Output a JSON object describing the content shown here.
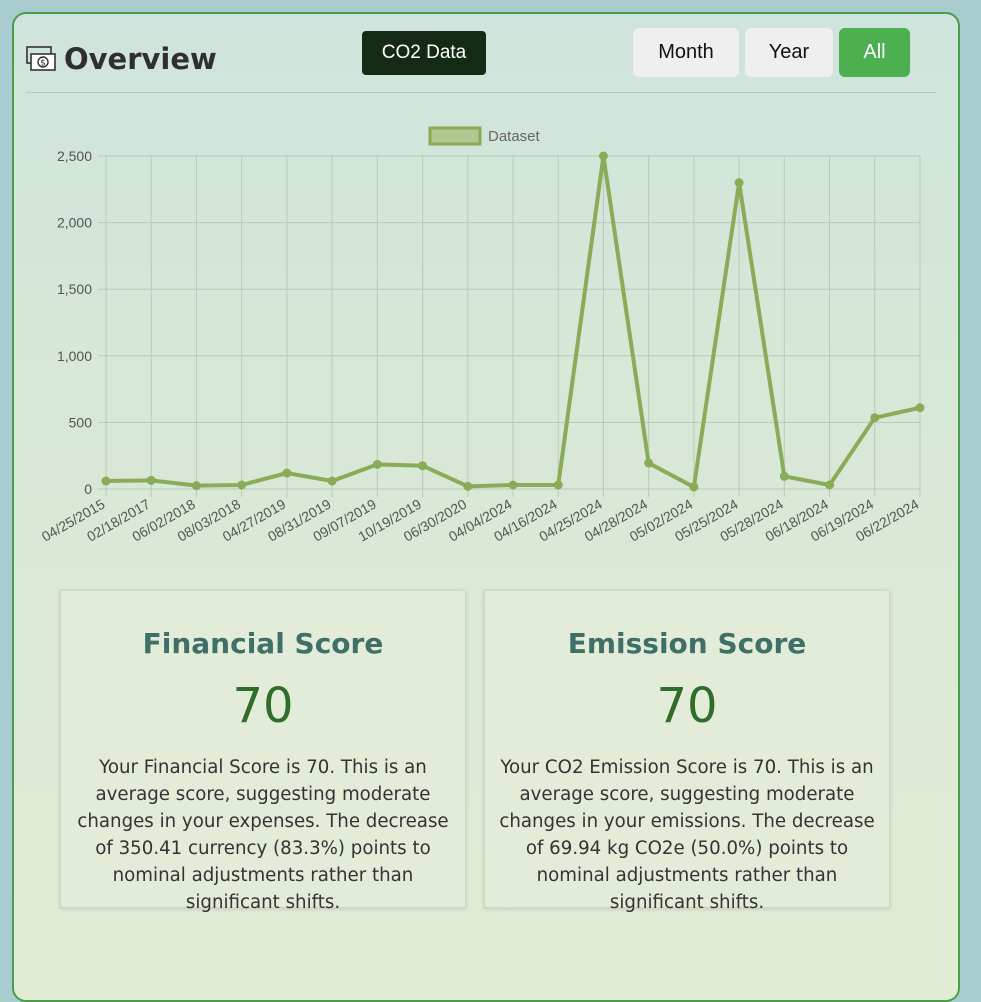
{
  "header": {
    "title": "Overview",
    "icon": "money-icon",
    "co2_button": "CO2 Data",
    "range_buttons": [
      "Month",
      "Year",
      "All"
    ],
    "active_range": "All"
  },
  "colors": {
    "accent": "#4caf50",
    "line": "#8aab58",
    "dark_button": "#142a14",
    "score_title": "#3e7068",
    "score_value": "#2f6e2a"
  },
  "chart_data": {
    "type": "line",
    "legend": "Dataset",
    "legend_position": "top",
    "grid": true,
    "ylim": [
      0,
      2500
    ],
    "y_ticks": [
      "0",
      "500",
      "1,000",
      "1,500",
      "2,000",
      "2,500"
    ],
    "categories": [
      "04/25/2015",
      "02/18/2017",
      "06/02/2018",
      "08/03/2018",
      "04/27/2019",
      "08/31/2019",
      "09/07/2019",
      "10/19/2019",
      "06/30/2020",
      "04/04/2024",
      "04/16/2024",
      "04/25/2024",
      "04/28/2024",
      "05/02/2024",
      "05/25/2024",
      "05/28/2024",
      "06/18/2024",
      "06/19/2024",
      "06/22/2024"
    ],
    "series": [
      {
        "name": "Dataset",
        "values": [
          60,
          65,
          25,
          30,
          120,
          60,
          185,
          175,
          20,
          30,
          30,
          2500,
          195,
          15,
          2300,
          95,
          30,
          535,
          610
        ]
      }
    ]
  },
  "financial": {
    "title": "Financial Score",
    "value": "70",
    "description": "Your Financial Score is 70. This is an average score, suggesting moderate changes in your expenses. The decrease of 350.41 currency (83.3%) points to nominal adjustments rather than significant shifts."
  },
  "emission": {
    "title": "Emission Score",
    "value": "70",
    "description": "Your CO2 Emission Score is 70. This is an average score, suggesting moderate changes in your emissions. The decrease of 69.94 kg CO2e (50.0%) points to nominal adjustments rather than significant shifts."
  }
}
